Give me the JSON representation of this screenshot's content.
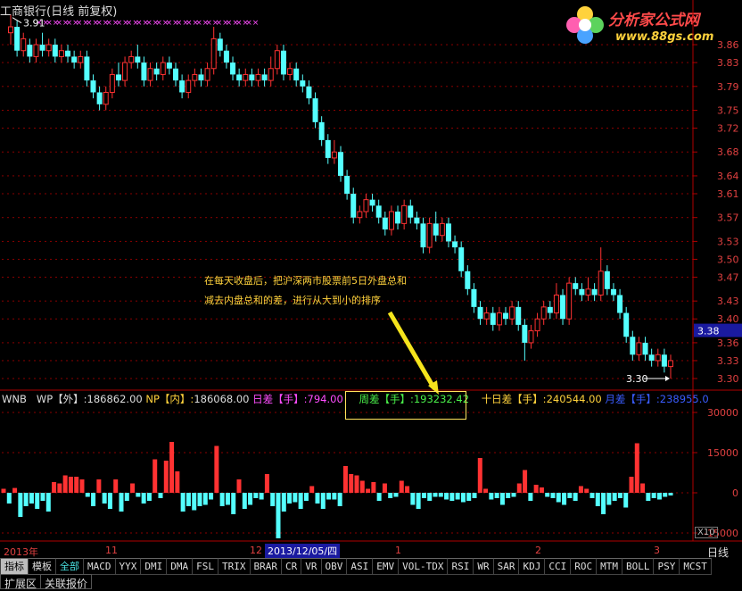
{
  "window": {
    "title": "工商银行(日线 前复权)"
  },
  "logo": {
    "name": "分析家公式网",
    "url": "www.88gs.com"
  },
  "colors": {
    "up": "#ff3232",
    "down": "#54ffff",
    "grid": "#8b0000",
    "axis": "#b00000",
    "mark": "#ff4dff",
    "note": "#ffd23c",
    "arrow": "#f5e41c"
  },
  "chart_data": [
    {
      "type": "candlestick",
      "y_ticks": [
        "3.86",
        "3.83",
        "3.79",
        "3.75",
        "3.72",
        "3.68",
        "3.64",
        "3.61",
        "3.57",
        "3.53",
        "3.50",
        "3.47",
        "3.43",
        "3.40",
        "3.36",
        "3.33",
        "3.30"
      ],
      "ylim": [
        3.288,
        3.905
      ],
      "current_price_label": "3.38",
      "current_price": 3.38,
      "high_label": "3.91",
      "low_label": "3.30",
      "marker": "××",
      "marker_count": 22,
      "candles": [
        [
          3.88,
          3.89,
          3.86,
          3.91
        ],
        [
          3.89,
          3.85,
          3.84,
          3.9
        ],
        [
          3.85,
          3.87,
          3.84,
          3.88
        ],
        [
          3.86,
          3.84,
          3.83,
          3.87
        ],
        [
          3.84,
          3.86,
          3.83,
          3.87
        ],
        [
          3.86,
          3.85,
          3.84,
          3.88
        ],
        [
          3.85,
          3.86,
          3.84,
          3.87
        ],
        [
          3.86,
          3.84,
          3.83,
          3.87
        ],
        [
          3.84,
          3.85,
          3.83,
          3.86
        ],
        [
          3.85,
          3.84,
          3.83,
          3.86
        ],
        [
          3.84,
          3.83,
          3.82,
          3.85
        ],
        [
          3.83,
          3.84,
          3.82,
          3.85
        ],
        [
          3.84,
          3.8,
          3.79,
          3.85
        ],
        [
          3.8,
          3.78,
          3.77,
          3.81
        ],
        [
          3.78,
          3.76,
          3.75,
          3.79
        ],
        [
          3.76,
          3.78,
          3.75,
          3.79
        ],
        [
          3.78,
          3.81,
          3.77,
          3.82
        ],
        [
          3.81,
          3.8,
          3.79,
          3.83
        ],
        [
          3.8,
          3.83,
          3.79,
          3.84
        ],
        [
          3.83,
          3.84,
          3.82,
          3.85
        ],
        [
          3.84,
          3.83,
          3.82,
          3.86
        ],
        [
          3.83,
          3.8,
          3.79,
          3.84
        ],
        [
          3.8,
          3.82,
          3.79,
          3.83
        ],
        [
          3.82,
          3.81,
          3.8,
          3.83
        ],
        [
          3.81,
          3.83,
          3.8,
          3.84
        ],
        [
          3.83,
          3.82,
          3.81,
          3.84
        ],
        [
          3.82,
          3.8,
          3.79,
          3.83
        ],
        [
          3.8,
          3.78,
          3.77,
          3.81
        ],
        [
          3.78,
          3.8,
          3.77,
          3.81
        ],
        [
          3.8,
          3.81,
          3.79,
          3.82
        ],
        [
          3.81,
          3.8,
          3.79,
          3.82
        ],
        [
          3.8,
          3.82,
          3.79,
          3.83
        ],
        [
          3.82,
          3.87,
          3.81,
          3.89
        ],
        [
          3.87,
          3.85,
          3.84,
          3.88
        ],
        [
          3.85,
          3.83,
          3.82,
          3.86
        ],
        [
          3.83,
          3.81,
          3.8,
          3.84
        ],
        [
          3.81,
          3.8,
          3.79,
          3.82
        ],
        [
          3.8,
          3.81,
          3.79,
          3.82
        ],
        [
          3.81,
          3.8,
          3.79,
          3.82
        ],
        [
          3.8,
          3.81,
          3.79,
          3.82
        ],
        [
          3.81,
          3.8,
          3.79,
          3.82
        ],
        [
          3.8,
          3.82,
          3.79,
          3.84
        ],
        [
          3.82,
          3.85,
          3.81,
          3.86
        ],
        [
          3.85,
          3.81,
          3.8,
          3.86
        ],
        [
          3.81,
          3.82,
          3.8,
          3.83
        ],
        [
          3.82,
          3.8,
          3.79,
          3.83
        ],
        [
          3.8,
          3.79,
          3.78,
          3.81
        ],
        [
          3.79,
          3.77,
          3.76,
          3.8
        ],
        [
          3.77,
          3.73,
          3.72,
          3.78
        ],
        [
          3.73,
          3.7,
          3.69,
          3.74
        ],
        [
          3.7,
          3.67,
          3.66,
          3.71
        ],
        [
          3.67,
          3.68,
          3.66,
          3.7
        ],
        [
          3.68,
          3.64,
          3.63,
          3.69
        ],
        [
          3.64,
          3.61,
          3.6,
          3.65
        ],
        [
          3.61,
          3.57,
          3.56,
          3.62
        ],
        [
          3.57,
          3.58,
          3.56,
          3.59
        ],
        [
          3.58,
          3.6,
          3.57,
          3.61
        ],
        [
          3.6,
          3.59,
          3.58,
          3.61
        ],
        [
          3.59,
          3.57,
          3.56,
          3.6
        ],
        [
          3.57,
          3.55,
          3.54,
          3.58
        ],
        [
          3.55,
          3.58,
          3.54,
          3.59
        ],
        [
          3.58,
          3.56,
          3.55,
          3.59
        ],
        [
          3.56,
          3.59,
          3.55,
          3.6
        ],
        [
          3.59,
          3.57,
          3.56,
          3.6
        ],
        [
          3.57,
          3.56,
          3.55,
          3.58
        ],
        [
          3.56,
          3.52,
          3.51,
          3.57
        ],
        [
          3.52,
          3.56,
          3.51,
          3.57
        ],
        [
          3.56,
          3.54,
          3.53,
          3.58
        ],
        [
          3.54,
          3.56,
          3.53,
          3.57
        ],
        [
          3.56,
          3.53,
          3.52,
          3.57
        ],
        [
          3.53,
          3.52,
          3.51,
          3.54
        ],
        [
          3.52,
          3.48,
          3.47,
          3.53
        ],
        [
          3.48,
          3.45,
          3.44,
          3.49
        ],
        [
          3.45,
          3.42,
          3.41,
          3.46
        ],
        [
          3.42,
          3.4,
          3.39,
          3.43
        ],
        [
          3.4,
          3.41,
          3.39,
          3.42
        ],
        [
          3.41,
          3.39,
          3.38,
          3.42
        ],
        [
          3.39,
          3.41,
          3.38,
          3.42
        ],
        [
          3.41,
          3.4,
          3.39,
          3.42
        ],
        [
          3.4,
          3.42,
          3.39,
          3.43
        ],
        [
          3.42,
          3.39,
          3.38,
          3.43
        ],
        [
          3.39,
          3.36,
          3.33,
          3.4
        ],
        [
          3.36,
          3.38,
          3.35,
          3.39
        ],
        [
          3.38,
          3.4,
          3.37,
          3.41
        ],
        [
          3.4,
          3.42,
          3.39,
          3.43
        ],
        [
          3.42,
          3.41,
          3.4,
          3.43
        ],
        [
          3.41,
          3.44,
          3.4,
          3.46
        ],
        [
          3.44,
          3.4,
          3.39,
          3.45
        ],
        [
          3.4,
          3.46,
          3.39,
          3.47
        ],
        [
          3.46,
          3.45,
          3.44,
          3.47
        ],
        [
          3.45,
          3.44,
          3.43,
          3.46
        ],
        [
          3.44,
          3.45,
          3.43,
          3.47
        ],
        [
          3.45,
          3.44,
          3.43,
          3.46
        ],
        [
          3.44,
          3.48,
          3.43,
          3.52
        ],
        [
          3.48,
          3.45,
          3.44,
          3.49
        ],
        [
          3.45,
          3.44,
          3.43,
          3.46
        ],
        [
          3.44,
          3.41,
          3.4,
          3.45
        ],
        [
          3.41,
          3.37,
          3.36,
          3.42
        ],
        [
          3.37,
          3.34,
          3.33,
          3.38
        ],
        [
          3.34,
          3.36,
          3.33,
          3.37
        ],
        [
          3.36,
          3.34,
          3.33,
          3.37
        ],
        [
          3.34,
          3.33,
          3.32,
          3.35
        ],
        [
          3.33,
          3.34,
          3.32,
          3.35
        ],
        [
          3.34,
          3.32,
          3.31,
          3.35
        ],
        [
          3.32,
          3.33,
          3.3,
          3.34
        ]
      ]
    },
    {
      "type": "bar",
      "title": "WNB",
      "y_ticks": [
        30000,
        15000,
        0,
        -15000
      ],
      "ylim": [
        -18000,
        36000
      ],
      "values": [
        1500,
        -4000,
        1800,
        -9000,
        -5000,
        -4000,
        -6000,
        -3000,
        -7000,
        4000,
        3500,
        6500,
        6000,
        6000,
        5000,
        -1500,
        -5000,
        5000,
        -4000,
        -6000,
        5000,
        -7000,
        -3000,
        3500,
        -1500,
        -4000,
        -3000,
        12500,
        -2000,
        12000,
        19000,
        8000,
        -7000,
        -5000,
        -6500,
        -5000,
        -4500,
        -2500,
        17500,
        -5000,
        -4500,
        -8000,
        5000,
        -6000,
        -4500,
        -2000,
        -2500,
        7000,
        -5000,
        -17000,
        -7000,
        -4000,
        -3500,
        -6000,
        -3000,
        2500,
        -4000,
        -6000,
        -2500,
        -2500,
        -5000,
        10000,
        7000,
        6500,
        4500,
        1500,
        4000,
        -3000,
        3500,
        -2000,
        -1500,
        4500,
        2500,
        -4500,
        -6000,
        -2000,
        -3000,
        -1500,
        -1500,
        -2500,
        -3000,
        -2500,
        -3500,
        -3000,
        -2000,
        13000,
        1500,
        -2500,
        -2000,
        -4500,
        -2000,
        -1500,
        3500,
        8500,
        -3000,
        3000,
        2000,
        -1500,
        -2000,
        -3500,
        -4500,
        -2000,
        -3000,
        2500,
        1500,
        -2000,
        -5000,
        -8000,
        -4500,
        -3000,
        -2000,
        -5500,
        6000,
        18500,
        3500,
        -3000,
        -2000,
        -2500,
        -1500,
        -1000
      ]
    }
  ],
  "indicator_line": {
    "name": "WNB",
    "wp_label": "WP【外】:",
    "wp_value": "186862.00",
    "np_label": "NP【内】:",
    "np_value": "186068.00",
    "rc_label": "日差【手】:",
    "rc_value": "794.00",
    "zc_label": "周差【手】:",
    "zc_value": "193232.42",
    "sr_label": "十日差【手】:",
    "sr_value": "240544.00",
    "yc_label": "月差【手】:",
    "yc_value": "238955.0"
  },
  "annotation": {
    "line1": "在每天收盘后，把沪深两市股票前5日外盘总和",
    "line2": "减去内盘总和的差，进行从大到小的排序"
  },
  "dates": {
    "year": "2013年",
    "m11": "11",
    "m12": "12",
    "cursor_date": "2013/12/05/四",
    "m1": "1",
    "m2": "2",
    "m3": "3"
  },
  "period_label": "日线",
  "scale_box": "X10",
  "tabs": [
    "指标",
    "模板",
    "全部",
    "MACD",
    "YYX",
    "DMI",
    "DMA",
    "FSL",
    "TRIX",
    "BRAR",
    "CR",
    "VR",
    "OBV",
    "ASI",
    "EMV",
    "VOL-TDX",
    "RSI",
    "WR",
    "SAR",
    "KDJ",
    "CCI",
    "ROC",
    "MTM",
    "BOLL",
    "PSY",
    "MCST"
  ],
  "bottom_tabs": [
    "扩展区",
    "关联报价"
  ]
}
